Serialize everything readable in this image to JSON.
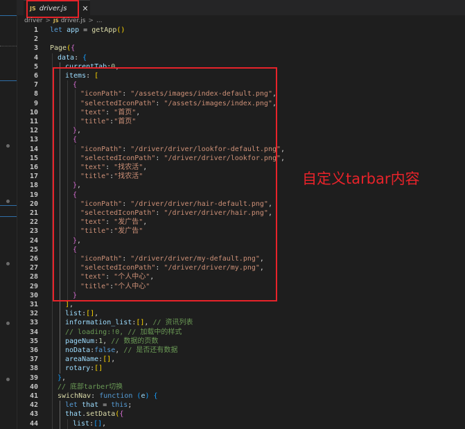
{
  "tab": {
    "language_badge": "JS",
    "filename": "driver.js",
    "close_glyph": "✕"
  },
  "breadcrumb": {
    "folder": "driver",
    "file_badge": "JS",
    "file": "driver.js",
    "separator": ">",
    "more": "..."
  },
  "annotation": {
    "text": "自定义tarbar内容"
  },
  "code_lines": [
    {
      "n": "1",
      "indent": 0,
      "tokens": [
        [
          "kw",
          "let"
        ],
        [
          "op",
          " "
        ],
        [
          "var",
          "app"
        ],
        [
          "op",
          " = "
        ],
        [
          "fn",
          "getApp"
        ],
        [
          "br1",
          "()"
        ]
      ]
    },
    {
      "n": "2",
      "indent": 0,
      "tokens": []
    },
    {
      "n": "3",
      "indent": 0,
      "tokens": [
        [
          "fn",
          "Page"
        ],
        [
          "br1",
          "("
        ],
        [
          "br2",
          "{"
        ]
      ]
    },
    {
      "n": "4",
      "indent": 1,
      "tokens": [
        [
          "var",
          "data"
        ],
        [
          "op",
          ": "
        ],
        [
          "br3",
          "{"
        ]
      ]
    },
    {
      "n": "5",
      "indent": 2,
      "tokens": [
        [
          "var",
          "currentTab"
        ],
        [
          "op",
          ":"
        ],
        [
          "num",
          "0"
        ],
        [
          "op",
          ","
        ]
      ]
    },
    {
      "n": "6",
      "indent": 2,
      "tokens": [
        [
          "var",
          "items"
        ],
        [
          "op",
          ": "
        ],
        [
          "br1",
          "["
        ]
      ]
    },
    {
      "n": "7",
      "indent": 3,
      "tokens": [
        [
          "br2",
          "{"
        ]
      ]
    },
    {
      "n": "8",
      "indent": 4,
      "tokens": [
        [
          "str",
          "\"iconPath\""
        ],
        [
          "op",
          ": "
        ],
        [
          "str",
          "\"/assets/images/index-default.png\""
        ],
        [
          "op",
          ","
        ]
      ]
    },
    {
      "n": "9",
      "indent": 4,
      "tokens": [
        [
          "str",
          "\"selectedIconPath\""
        ],
        [
          "op",
          ": "
        ],
        [
          "str",
          "\"/assets/images/index.png\""
        ],
        [
          "op",
          ","
        ]
      ]
    },
    {
      "n": "10",
      "indent": 4,
      "tokens": [
        [
          "str",
          "\"text\""
        ],
        [
          "op",
          ": "
        ],
        [
          "str",
          "\"首页\""
        ],
        [
          "op",
          ","
        ]
      ]
    },
    {
      "n": "11",
      "indent": 4,
      "tokens": [
        [
          "str",
          "\"title\""
        ],
        [
          "op",
          ":"
        ],
        [
          "str",
          "\"首页\""
        ]
      ]
    },
    {
      "n": "12",
      "indent": 3,
      "tokens": [
        [
          "br2",
          "}"
        ],
        [
          "op",
          ","
        ]
      ]
    },
    {
      "n": "13",
      "indent": 3,
      "tokens": [
        [
          "br2",
          "{"
        ]
      ]
    },
    {
      "n": "14",
      "indent": 4,
      "tokens": [
        [
          "str",
          "\"iconPath\""
        ],
        [
          "op",
          ": "
        ],
        [
          "str",
          "\"/driver/driver/lookfor-default.png\""
        ],
        [
          "op",
          ","
        ]
      ]
    },
    {
      "n": "15",
      "indent": 4,
      "tokens": [
        [
          "str",
          "\"selectedIconPath\""
        ],
        [
          "op",
          ": "
        ],
        [
          "str",
          "\"/driver/driver/lookfor.png\""
        ],
        [
          "op",
          ","
        ]
      ]
    },
    {
      "n": "16",
      "indent": 4,
      "tokens": [
        [
          "str",
          "\"text\""
        ],
        [
          "op",
          ": "
        ],
        [
          "str",
          "\"找农活\""
        ],
        [
          "op",
          ","
        ]
      ]
    },
    {
      "n": "17",
      "indent": 4,
      "tokens": [
        [
          "str",
          "\"title\""
        ],
        [
          "op",
          ":"
        ],
        [
          "str",
          "\"找农活\""
        ]
      ]
    },
    {
      "n": "18",
      "indent": 3,
      "tokens": [
        [
          "br2",
          "}"
        ],
        [
          "op",
          ","
        ]
      ]
    },
    {
      "n": "19",
      "indent": 3,
      "tokens": [
        [
          "br2",
          "{"
        ]
      ]
    },
    {
      "n": "20",
      "indent": 4,
      "tokens": [
        [
          "str",
          "\"iconPath\""
        ],
        [
          "op",
          ": "
        ],
        [
          "str",
          "\"/driver/driver/hair-default.png\""
        ],
        [
          "op",
          ","
        ]
      ]
    },
    {
      "n": "21",
      "indent": 4,
      "tokens": [
        [
          "str",
          "\"selectedIconPath\""
        ],
        [
          "op",
          ": "
        ],
        [
          "str",
          "\"/driver/driver/hair.png\""
        ],
        [
          "op",
          ","
        ]
      ]
    },
    {
      "n": "22",
      "indent": 4,
      "tokens": [
        [
          "str",
          "\"text\""
        ],
        [
          "op",
          ": "
        ],
        [
          "str",
          "\"发广告\""
        ],
        [
          "op",
          ","
        ]
      ]
    },
    {
      "n": "23",
      "indent": 4,
      "tokens": [
        [
          "str",
          "\"title\""
        ],
        [
          "op",
          ":"
        ],
        [
          "str",
          "\"发广告\""
        ]
      ]
    },
    {
      "n": "24",
      "indent": 3,
      "tokens": [
        [
          "br2",
          "}"
        ],
        [
          "op",
          ","
        ]
      ]
    },
    {
      "n": "25",
      "indent": 3,
      "tokens": [
        [
          "br2",
          "{"
        ]
      ]
    },
    {
      "n": "26",
      "indent": 4,
      "tokens": [
        [
          "str",
          "\"iconPath\""
        ],
        [
          "op",
          ": "
        ],
        [
          "str",
          "\"/driver/driver/my-default.png\""
        ],
        [
          "op",
          ","
        ]
      ]
    },
    {
      "n": "27",
      "indent": 4,
      "tokens": [
        [
          "str",
          "\"selectedIconPath\""
        ],
        [
          "op",
          ": "
        ],
        [
          "str",
          "\"/driver/driver/my.png\""
        ],
        [
          "op",
          ","
        ]
      ]
    },
    {
      "n": "28",
      "indent": 4,
      "tokens": [
        [
          "str",
          "\"text\""
        ],
        [
          "op",
          ": "
        ],
        [
          "str",
          "\"个人中心\""
        ],
        [
          "op",
          ","
        ]
      ]
    },
    {
      "n": "29",
      "indent": 4,
      "tokens": [
        [
          "str",
          "\"title\""
        ],
        [
          "op",
          ":"
        ],
        [
          "str",
          "\"个人中心\""
        ]
      ]
    },
    {
      "n": "30",
      "indent": 3,
      "tokens": [
        [
          "br2",
          "}"
        ]
      ]
    },
    {
      "n": "31",
      "indent": 2,
      "tokens": [
        [
          "br1",
          "]"
        ],
        [
          "op",
          ","
        ]
      ]
    },
    {
      "n": "32",
      "indent": 2,
      "tokens": [
        [
          "var",
          "list"
        ],
        [
          "op",
          ":"
        ],
        [
          "br1",
          "[]"
        ],
        [
          "op",
          ","
        ]
      ]
    },
    {
      "n": "33",
      "indent": 2,
      "tokens": [
        [
          "var",
          "information_list"
        ],
        [
          "op",
          ":"
        ],
        [
          "br1",
          "[]"
        ],
        [
          "op",
          ", "
        ],
        [
          "com",
          "// 资讯列表"
        ]
      ]
    },
    {
      "n": "34",
      "indent": 2,
      "tokens": [
        [
          "com",
          "// loading:!0, // 加载中的样式"
        ]
      ]
    },
    {
      "n": "35",
      "indent": 2,
      "tokens": [
        [
          "var",
          "pageNum"
        ],
        [
          "op",
          ":"
        ],
        [
          "num",
          "1"
        ],
        [
          "op",
          ", "
        ],
        [
          "com",
          "// 数据的页数"
        ]
      ]
    },
    {
      "n": "36",
      "indent": 2,
      "tokens": [
        [
          "var",
          "noData"
        ],
        [
          "op",
          ":"
        ],
        [
          "kw",
          "false"
        ],
        [
          "op",
          ", "
        ],
        [
          "com",
          "// 是否还有数据"
        ]
      ]
    },
    {
      "n": "37",
      "indent": 2,
      "tokens": [
        [
          "var",
          "areaName"
        ],
        [
          "op",
          ":"
        ],
        [
          "br1",
          "[]"
        ],
        [
          "op",
          ","
        ]
      ]
    },
    {
      "n": "38",
      "indent": 2,
      "tokens": [
        [
          "var",
          "rotary"
        ],
        [
          "op",
          ":"
        ],
        [
          "br1",
          "[]"
        ]
      ]
    },
    {
      "n": "39",
      "indent": 1,
      "tokens": [
        [
          "br3",
          "}"
        ],
        [
          "op",
          ","
        ]
      ]
    },
    {
      "n": "40",
      "indent": 1,
      "tokens": [
        [
          "com",
          "// 底部tarber切换"
        ]
      ]
    },
    {
      "n": "41",
      "indent": 1,
      "tokens": [
        [
          "fn",
          "swichNav"
        ],
        [
          "op",
          ": "
        ],
        [
          "kw",
          "function"
        ],
        [
          "op",
          " "
        ],
        [
          "br3",
          "("
        ],
        [
          "var",
          "e"
        ],
        [
          "br3",
          ")"
        ],
        [
          "op",
          " "
        ],
        [
          "br3",
          "{"
        ]
      ]
    },
    {
      "n": "42",
      "indent": 2,
      "tokens": [
        [
          "kw",
          "let"
        ],
        [
          "op",
          " "
        ],
        [
          "var",
          "that"
        ],
        [
          "op",
          " = "
        ],
        [
          "kw",
          "this"
        ],
        [
          "op",
          ";"
        ]
      ]
    },
    {
      "n": "43",
      "indent": 2,
      "tokens": [
        [
          "var",
          "that"
        ],
        [
          "op",
          "."
        ],
        [
          "fn",
          "setData"
        ],
        [
          "br1",
          "("
        ],
        [
          "br2",
          "{"
        ]
      ]
    },
    {
      "n": "44",
      "indent": 3,
      "tokens": [
        [
          "var",
          "list"
        ],
        [
          "op",
          ":"
        ],
        [
          "br3",
          "[]"
        ],
        [
          "op",
          ","
        ]
      ]
    }
  ]
}
